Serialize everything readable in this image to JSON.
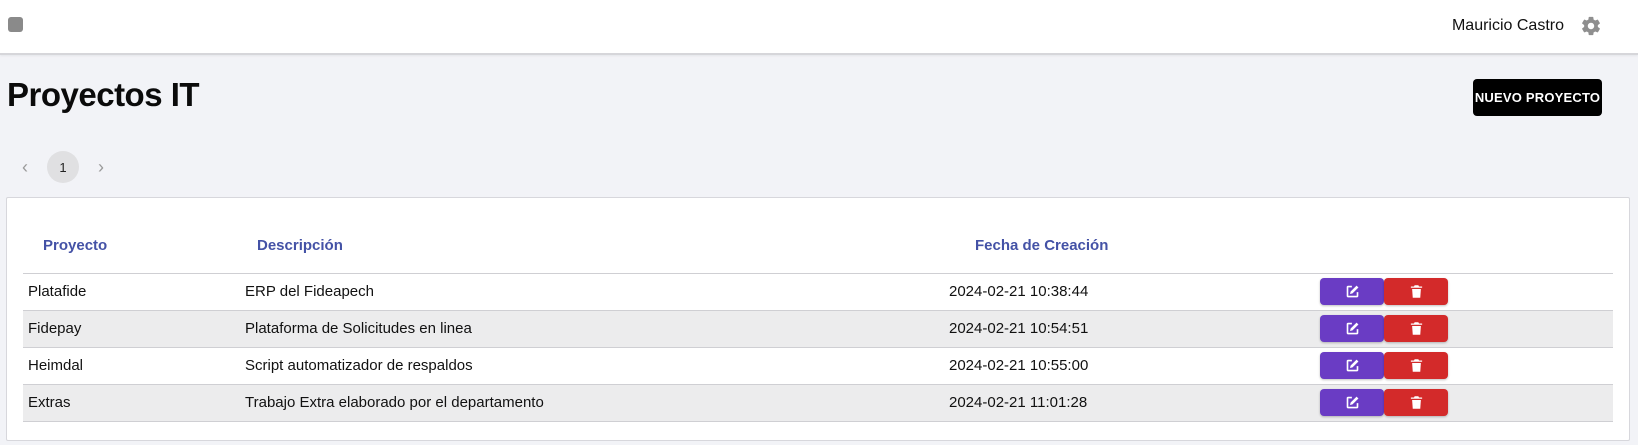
{
  "header": {
    "user_name": "Mauricio Castro",
    "menu_icon": "menu-square-icon",
    "settings_icon": "gear-icon"
  },
  "page": {
    "title": "Proyectos IT",
    "new_button_label": "NUEVO PROYECTO"
  },
  "pagination": {
    "current_page": "1",
    "prev_icon": "chevron-left-icon",
    "next_icon": "chevron-right-icon"
  },
  "table": {
    "columns": [
      "Proyecto",
      "Descripción",
      "Fecha de Creación",
      ""
    ],
    "rows": [
      {
        "proyecto": "Platafide",
        "descripcion": "ERP del Fideapech",
        "fecha": "2024-02-21 10:38:44"
      },
      {
        "proyecto": "Fidepay",
        "descripcion": "Plataforma de Solicitudes en linea",
        "fecha": "2024-02-21 10:54:51"
      },
      {
        "proyecto": "Heimdal",
        "descripcion": "Script automatizador de respaldos",
        "fecha": "2024-02-21 10:55:00"
      },
      {
        "proyecto": "Extras",
        "descripcion": "Trabajo Extra elaborado por el departamento",
        "fecha": "2024-02-21 11:01:28"
      }
    ],
    "row_actions": {
      "edit_icon": "edit-icon",
      "delete_icon": "trash-icon"
    }
  },
  "colors": {
    "header_text": "#4452a6",
    "edit_button": "#6a3cc4",
    "delete_button": "#d32a2a",
    "primary_button": "#000000"
  }
}
